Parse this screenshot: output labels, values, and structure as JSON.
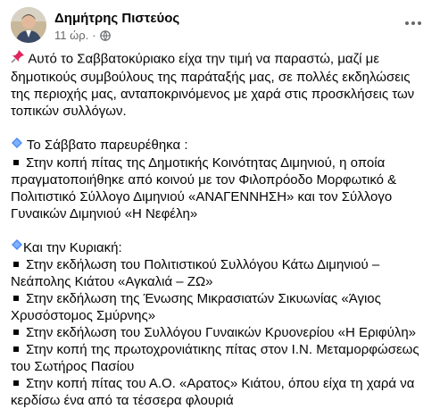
{
  "post": {
    "author": "Δημήτρης Πιστεύος",
    "time": "11 ώρ.",
    "separator": "·",
    "intro": "Αυτό το Σαββατοκύριακο είχα την τιμή να παραστώ, μαζί με δημοτικούς συμβούλους της παράταξής μας, σε πολλές εκδηλώσεις της περιοχής μας, ανταποκρινόμενος με χαρά στις προσκλήσεις των τοπικών συλλόγων.",
    "saturday_heading": "Το Σάββατο παρευρέθηκα :",
    "saturday_items": [
      "Στην κοπή πίτας της Δημοτικής Κοινότητας Διμηνιού, η οποία πραγματοποιήθηκε από κοινού με τον Φιλοπρόοδο Μορφωτικό & Πολιτιστικό Σύλλογο Διμηνιού «ΑΝΑΓΕΝΝΗΣΗ» και τον Σύλλογο Γυναικών Διμηνιού «Η Νεφέλη»"
    ],
    "sunday_heading": "Και την Κυριακή:",
    "sunday_items": [
      "Στην εκδήλωση του Πολιτιστικού Συλλόγου Κάτω Διμηνιού – Νεάπολης Κιάτου «Αγκαλιά – ΖΩ»",
      "Στην εκδήλωση της Ένωσης Μικρασιατών Σικυωνίας «Άγιος Χρυσόστομος Σμύρνης»",
      "Στην εκδήλωση του Συλλόγου Γυναικών Κρυονερίου «Η Εριφύλη»",
      "Στην κοπή της πρωτοχρονιάτικης πίτας στον Ι.Ν. Μεταμορφώσεως του Σωτήρος Πασίου",
      "Στην κοπή πίτας του Α.Ο. «Αρατος» Κιάτου, όπου είχα τη χαρά να κερδίσω ένα από τα τέσσερα φλουριά"
    ],
    "icons": {
      "pin": "pushpin-icon",
      "diamond": "blue-diamond-icon",
      "bullet": "black-square-icon",
      "privacy": "globe-icon",
      "menu": "more-dots-icon"
    },
    "colors": {
      "text": "#050505",
      "meta": "#65676b",
      "pin": "#e0245e",
      "diamond": "#4c8bf5"
    }
  }
}
